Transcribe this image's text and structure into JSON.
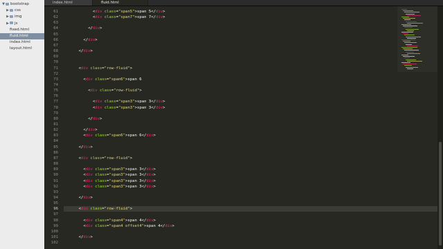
{
  "sidebar": {
    "items": [
      {
        "label": "bootstrap",
        "depth": 0,
        "folder": true,
        "open": true,
        "selected": false
      },
      {
        "label": "css",
        "depth": 1,
        "folder": true,
        "open": false,
        "selected": false
      },
      {
        "label": "img",
        "depth": 1,
        "folder": true,
        "open": false,
        "selected": false
      },
      {
        "label": "js",
        "depth": 1,
        "folder": true,
        "open": false,
        "selected": false
      },
      {
        "label": "fixed.html",
        "depth": 1,
        "folder": false,
        "open": false,
        "selected": false
      },
      {
        "label": "fluid.html",
        "depth": 1,
        "folder": false,
        "open": false,
        "selected": true
      },
      {
        "label": "index.html",
        "depth": 1,
        "folder": false,
        "open": false,
        "selected": false
      },
      {
        "label": "layout.html",
        "depth": 1,
        "folder": false,
        "open": false,
        "selected": false
      }
    ]
  },
  "tabs": [
    {
      "label": "index.html",
      "active": false
    },
    {
      "label": "fluid.html",
      "active": true
    }
  ],
  "editor": {
    "current_line": 96,
    "lines": [
      {
        "n": 61,
        "indent": 10,
        "tokens": [
          [
            "<",
            "pun"
          ],
          [
            "div",
            "tag"
          ],
          [
            " class",
            "atr"
          ],
          [
            "=",
            "pun"
          ],
          [
            "\"span5\"",
            "str"
          ],
          [
            ">",
            "pun"
          ],
          [
            "span 5",
            "txt"
          ],
          [
            "</",
            "pun"
          ],
          [
            "div",
            "tag"
          ],
          [
            ">",
            "pun"
          ]
        ]
      },
      {
        "n": 62,
        "indent": 10,
        "tokens": [
          [
            "<",
            "pun"
          ],
          [
            "div",
            "tag"
          ],
          [
            " class",
            "atr"
          ],
          [
            "=",
            "pun"
          ],
          [
            "\"span7\"",
            "str"
          ],
          [
            ">",
            "pun"
          ],
          [
            "span 7",
            "txt"
          ],
          [
            "</",
            "pun"
          ],
          [
            "div",
            "tag"
          ],
          [
            ">",
            "pun"
          ]
        ]
      },
      {
        "n": 63,
        "indent": 0,
        "tokens": []
      },
      {
        "n": 64,
        "indent": 8,
        "tokens": [
          [
            "</",
            "pun"
          ],
          [
            "div",
            "tag"
          ],
          [
            ">",
            "pun"
          ]
        ]
      },
      {
        "n": 65,
        "indent": 0,
        "tokens": []
      },
      {
        "n": 66,
        "indent": 6,
        "tokens": [
          [
            "</",
            "pun"
          ],
          [
            "div",
            "tag"
          ],
          [
            ">",
            "pun"
          ]
        ]
      },
      {
        "n": 67,
        "indent": 0,
        "tokens": []
      },
      {
        "n": 68,
        "indent": 4,
        "tokens": [
          [
            "</",
            "pun"
          ],
          [
            "div",
            "tag"
          ],
          [
            ">",
            "pun"
          ]
        ]
      },
      {
        "n": 69,
        "indent": 0,
        "tokens": []
      },
      {
        "n": 70,
        "indent": 0,
        "tokens": []
      },
      {
        "n": 71,
        "indent": 4,
        "tokens": [
          [
            "<",
            "pun"
          ],
          [
            "div",
            "tag"
          ],
          [
            " class",
            "atr"
          ],
          [
            "=",
            "pun"
          ],
          [
            "\"row-fluid\"",
            "str"
          ],
          [
            ">",
            "pun"
          ]
        ]
      },
      {
        "n": 72,
        "indent": 0,
        "tokens": []
      },
      {
        "n": 73,
        "indent": 6,
        "tokens": [
          [
            "<",
            "pun"
          ],
          [
            "div",
            "tag"
          ],
          [
            " class",
            "atr"
          ],
          [
            "=",
            "pun"
          ],
          [
            "\"span6\"",
            "str"
          ],
          [
            ">",
            "pun"
          ],
          [
            "span 6",
            "txt"
          ]
        ]
      },
      {
        "n": 74,
        "indent": 0,
        "tokens": []
      },
      {
        "n": 75,
        "indent": 8,
        "tokens": [
          [
            "<",
            "pun"
          ],
          [
            "div",
            "tag"
          ],
          [
            " class",
            "atr"
          ],
          [
            "=",
            "pun"
          ],
          [
            "\"row-fluid\"",
            "str"
          ],
          [
            ">",
            "pun"
          ]
        ]
      },
      {
        "n": 76,
        "indent": 0,
        "tokens": []
      },
      {
        "n": 77,
        "indent": 10,
        "tokens": [
          [
            "<",
            "pun"
          ],
          [
            "div",
            "tag"
          ],
          [
            " class",
            "atr"
          ],
          [
            "=",
            "pun"
          ],
          [
            "\"span3\"",
            "str"
          ],
          [
            ">",
            "pun"
          ],
          [
            "span 3",
            "txt"
          ],
          [
            "</",
            "pun"
          ],
          [
            "div",
            "tag"
          ],
          [
            ">",
            "pun"
          ]
        ]
      },
      {
        "n": 78,
        "indent": 10,
        "tokens": [
          [
            "<",
            "pun"
          ],
          [
            "div",
            "tag"
          ],
          [
            " class",
            "atr"
          ],
          [
            "=",
            "pun"
          ],
          [
            "\"span3\"",
            "str"
          ],
          [
            ">",
            "pun"
          ],
          [
            "span 3",
            "txt"
          ],
          [
            "</",
            "pun"
          ],
          [
            "div",
            "tag"
          ],
          [
            ">",
            "pun"
          ]
        ]
      },
      {
        "n": 79,
        "indent": 0,
        "tokens": []
      },
      {
        "n": 80,
        "indent": 8,
        "tokens": [
          [
            "</",
            "pun"
          ],
          [
            "div",
            "tag"
          ],
          [
            ">",
            "pun"
          ]
        ]
      },
      {
        "n": 81,
        "indent": 0,
        "tokens": []
      },
      {
        "n": 82,
        "indent": 6,
        "tokens": [
          [
            "</",
            "pun"
          ],
          [
            "div",
            "tag"
          ],
          [
            ">",
            "pun"
          ]
        ]
      },
      {
        "n": 83,
        "indent": 6,
        "tokens": [
          [
            "<",
            "pun"
          ],
          [
            "div",
            "tag"
          ],
          [
            " class",
            "atr"
          ],
          [
            "=",
            "pun"
          ],
          [
            "\"span6\"",
            "str"
          ],
          [
            ">",
            "pun"
          ],
          [
            "span 6",
            "txt"
          ],
          [
            "</",
            "pun"
          ],
          [
            "div",
            "tag"
          ],
          [
            ">",
            "pun"
          ]
        ]
      },
      {
        "n": 84,
        "indent": 0,
        "tokens": []
      },
      {
        "n": 85,
        "indent": 4,
        "tokens": [
          [
            "</",
            "pun"
          ],
          [
            "div",
            "tag"
          ],
          [
            ">",
            "pun"
          ]
        ]
      },
      {
        "n": 86,
        "indent": 0,
        "tokens": []
      },
      {
        "n": 87,
        "indent": 4,
        "tokens": [
          [
            "<",
            "pun"
          ],
          [
            "div",
            "tag"
          ],
          [
            " class",
            "atr"
          ],
          [
            "=",
            "pun"
          ],
          [
            "\"row-fluid\"",
            "str"
          ],
          [
            ">",
            "pun"
          ]
        ]
      },
      {
        "n": 88,
        "indent": 0,
        "tokens": []
      },
      {
        "n": 89,
        "indent": 6,
        "tokens": [
          [
            "<",
            "pun"
          ],
          [
            "div",
            "tag"
          ],
          [
            " class",
            "atr"
          ],
          [
            "=",
            "pun"
          ],
          [
            "\"span3\"",
            "str"
          ],
          [
            ">",
            "pun"
          ],
          [
            "span 3",
            "txt"
          ],
          [
            "</",
            "pun"
          ],
          [
            "div",
            "tag"
          ],
          [
            ">",
            "pun"
          ]
        ]
      },
      {
        "n": 90,
        "indent": 6,
        "tokens": [
          [
            "<",
            "pun"
          ],
          [
            "div",
            "tag"
          ],
          [
            " class",
            "atr"
          ],
          [
            "=",
            "pun"
          ],
          [
            "\"span3\"",
            "str"
          ],
          [
            ">",
            "pun"
          ],
          [
            "span 3",
            "txt"
          ],
          [
            "</",
            "pun"
          ],
          [
            "div",
            "tag"
          ],
          [
            ">",
            "pun"
          ]
        ]
      },
      {
        "n": 91,
        "indent": 6,
        "tokens": [
          [
            "<",
            "pun"
          ],
          [
            "div",
            "tag"
          ],
          [
            " class",
            "atr"
          ],
          [
            "=",
            "pun"
          ],
          [
            "\"span3\"",
            "str"
          ],
          [
            ">",
            "pun"
          ],
          [
            "span 3",
            "txt"
          ],
          [
            "</",
            "pun"
          ],
          [
            "div",
            "tag"
          ],
          [
            ">",
            "pun"
          ]
        ]
      },
      {
        "n": 92,
        "indent": 6,
        "tokens": [
          [
            "<",
            "pun"
          ],
          [
            "div",
            "tag"
          ],
          [
            " class",
            "atr"
          ],
          [
            "=",
            "pun"
          ],
          [
            "\"span3\"",
            "str"
          ],
          [
            ">",
            "pun"
          ],
          [
            "span 3",
            "txt"
          ],
          [
            "</",
            "pun"
          ],
          [
            "div",
            "tag"
          ],
          [
            ">",
            "pun"
          ]
        ]
      },
      {
        "n": 93,
        "indent": 0,
        "tokens": []
      },
      {
        "n": 94,
        "indent": 4,
        "tokens": [
          [
            "</",
            "pun"
          ],
          [
            "div",
            "tag"
          ],
          [
            ">",
            "pun"
          ]
        ]
      },
      {
        "n": 95,
        "indent": 0,
        "tokens": []
      },
      {
        "n": 96,
        "indent": 4,
        "tokens": [
          [
            "<",
            "pun"
          ],
          [
            "div",
            "tag"
          ],
          [
            " class",
            "atr"
          ],
          [
            "=",
            "pun"
          ],
          [
            "\"row-fluid\"",
            "str"
          ],
          [
            ">",
            "pun"
          ]
        ]
      },
      {
        "n": 97,
        "indent": 0,
        "tokens": []
      },
      {
        "n": 98,
        "indent": 6,
        "tokens": [
          [
            "<",
            "pun"
          ],
          [
            "div",
            "tag"
          ],
          [
            " class",
            "atr"
          ],
          [
            "=",
            "pun"
          ],
          [
            "\"span4\"",
            "str"
          ],
          [
            ">",
            "pun"
          ],
          [
            "span 4",
            "txt"
          ],
          [
            "</",
            "pun"
          ],
          [
            "div",
            "tag"
          ],
          [
            ">",
            "pun"
          ]
        ]
      },
      {
        "n": 99,
        "indent": 6,
        "tokens": [
          [
            "<",
            "pun"
          ],
          [
            "div",
            "tag"
          ],
          [
            " class",
            "atr"
          ],
          [
            "=",
            "pun"
          ],
          [
            "\"span4 offset4\"",
            "str"
          ],
          [
            ">",
            "pun"
          ],
          [
            "span 4",
            "txt"
          ],
          [
            "</",
            "pun"
          ],
          [
            "div",
            "tag"
          ],
          [
            ">",
            "pun"
          ]
        ]
      },
      {
        "n": 100,
        "indent": 0,
        "tokens": []
      },
      {
        "n": 101,
        "indent": 4,
        "tokens": [
          [
            "</",
            "pun"
          ],
          [
            "div",
            "tag"
          ],
          [
            ">",
            "pun"
          ]
        ]
      },
      {
        "n": 102,
        "indent": 0,
        "tokens": []
      }
    ]
  },
  "colors": {
    "background": "#272822",
    "tag": "#f92672",
    "attribute": "#a6e22e",
    "string": "#e6db74",
    "text": "#f8f8f2",
    "gutter_text": "#8f908a",
    "sidebar_selected": "#7f8ea0"
  }
}
